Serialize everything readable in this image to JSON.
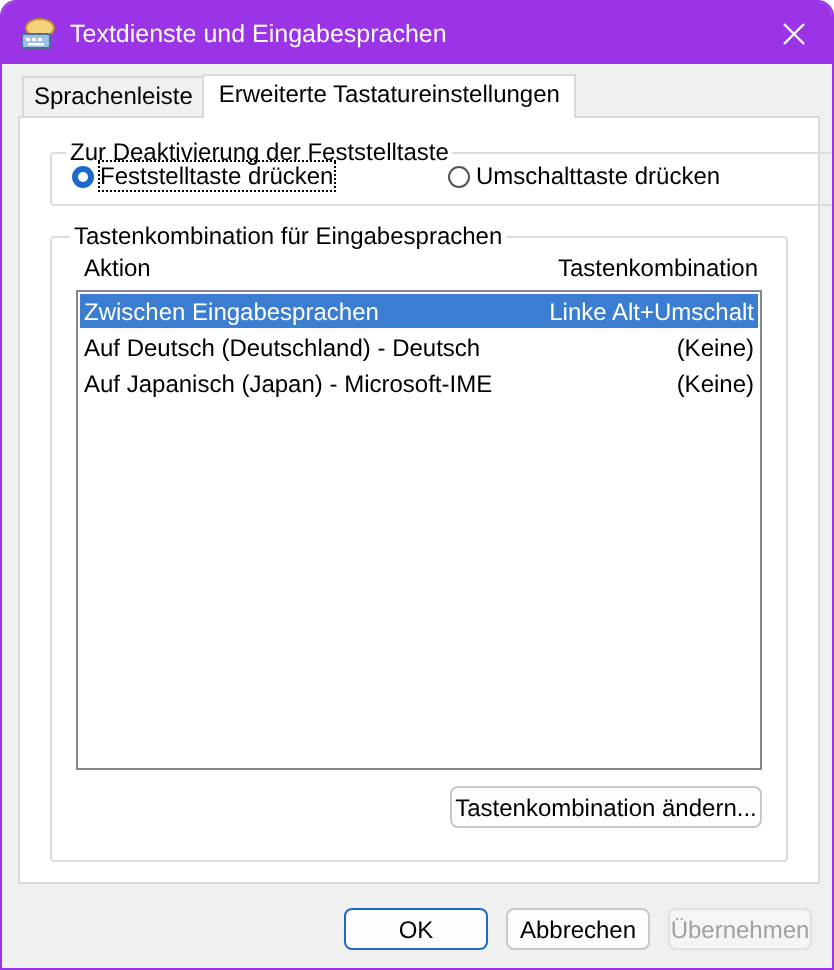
{
  "window": {
    "title": "Textdienste und Eingabesprachen"
  },
  "tabs": [
    {
      "label": "Sprachenleiste",
      "selected": false
    },
    {
      "label": "Erweiterte Tastatureinstellungen",
      "selected": true
    }
  ],
  "capslock_group": {
    "title": "Zur Deaktivierung der Feststelltaste",
    "options": [
      {
        "label": "Feststelltaste drücken",
        "selected": true
      },
      {
        "label": "Umschalttaste drücken",
        "selected": false
      }
    ]
  },
  "hotkey_group": {
    "title": "Tastenkombination für Eingabesprachen",
    "columns": [
      "Aktion",
      "Tastenkombination"
    ],
    "rows": [
      {
        "action": "Zwischen Eingabesprachen",
        "hotkey": "Linke Alt+Umschalt",
        "selected": true
      },
      {
        "action": "Auf Deutsch (Deutschland) - Deutsch",
        "hotkey": "(Keine)",
        "selected": false
      },
      {
        "action": "Auf Japanisch (Japan) - Microsoft-IME",
        "hotkey": "(Keine)",
        "selected": false
      }
    ],
    "button": "Tastenkombination ändern..."
  },
  "buttons": [
    {
      "label": "OK",
      "kind": "default",
      "disabled": false
    },
    {
      "label": "Abbrechen",
      "kind": "normal",
      "disabled": false
    },
    {
      "label": "Übernehmen",
      "kind": "normal",
      "disabled": true
    }
  ]
}
